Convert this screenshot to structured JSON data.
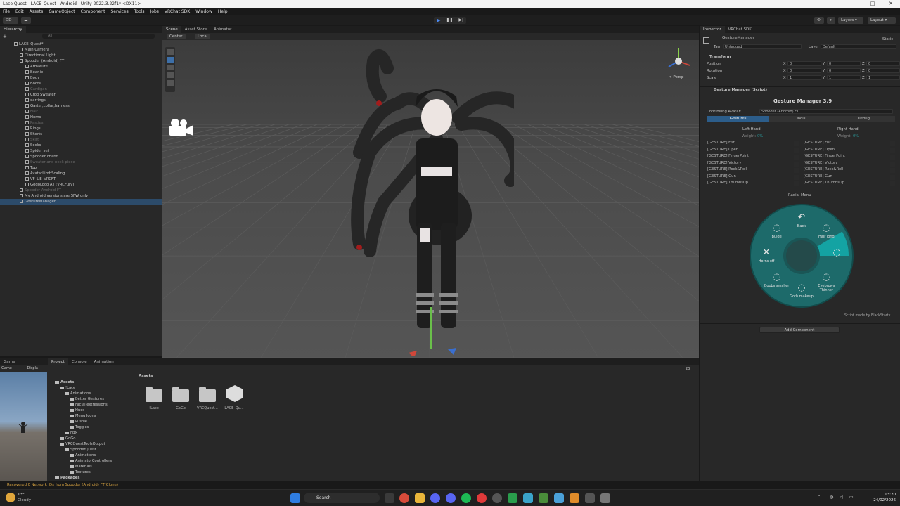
{
  "window": {
    "title": "Lace Quest - LACE_Quest - Android - Unity 2022.3.22f1* <DX11>",
    "controls": [
      "–",
      "□",
      "✕"
    ]
  },
  "menu": [
    "File",
    "Edit",
    "Assets",
    "GameObject",
    "Component",
    "Services",
    "Tools",
    "Jobs",
    "VRChat SDK",
    "Window",
    "Help"
  ],
  "toolbar": {
    "account": "DD",
    "layers": "Layers",
    "layout": "Layout"
  },
  "hierarchy": {
    "tab": "Hierarchy",
    "search_placeholder": "All",
    "items": [
      {
        "label": "LACE_Quest*",
        "indent": 0,
        "dim": false,
        "sel": false
      },
      {
        "label": "Main Camera",
        "indent": 1,
        "dim": false,
        "sel": false
      },
      {
        "label": "Directional Light",
        "indent": 1,
        "dim": false,
        "sel": false
      },
      {
        "label": "Spooder (Android) FT",
        "indent": 1,
        "dim": false,
        "sel": false
      },
      {
        "label": "Armature",
        "indent": 2,
        "dim": false,
        "sel": false
      },
      {
        "label": "Beanie",
        "indent": 2,
        "dim": false,
        "sel": false
      },
      {
        "label": "Body",
        "indent": 2,
        "dim": false,
        "sel": false
      },
      {
        "label": "Boots",
        "indent": 2,
        "dim": false,
        "sel": false
      },
      {
        "label": "Cardigan",
        "indent": 2,
        "dim": true,
        "sel": false
      },
      {
        "label": "Crop Sweater",
        "indent": 2,
        "dim": false,
        "sel": false
      },
      {
        "label": "earrings",
        "indent": 2,
        "dim": false,
        "sel": false
      },
      {
        "label": "Garter,collar,harness",
        "indent": 2,
        "dim": false,
        "sel": false
      },
      {
        "label": "Hair",
        "indent": 2,
        "dim": true,
        "sel": false
      },
      {
        "label": "Horns",
        "indent": 2,
        "dim": false,
        "sel": false
      },
      {
        "label": "Pasties",
        "indent": 2,
        "dim": true,
        "sel": false
      },
      {
        "label": "Rings",
        "indent": 2,
        "dim": false,
        "sel": false
      },
      {
        "label": "Shorts",
        "indent": 2,
        "dim": false,
        "sel": false
      },
      {
        "label": "Skirt",
        "indent": 2,
        "dim": true,
        "sel": false
      },
      {
        "label": "Socks",
        "indent": 2,
        "dim": false,
        "sel": false
      },
      {
        "label": "Spider set",
        "indent": 2,
        "dim": false,
        "sel": false
      },
      {
        "label": "Spooder charm",
        "indent": 2,
        "dim": false,
        "sel": false
      },
      {
        "label": "Sweater and neck piece",
        "indent": 2,
        "dim": true,
        "sel": false
      },
      {
        "label": "Top",
        "indent": 2,
        "dim": false,
        "sel": false
      },
      {
        "label": "AvatarLimbScaling",
        "indent": 2,
        "dim": false,
        "sel": false
      },
      {
        "label": "VF_UE_VRCFT",
        "indent": 2,
        "dim": false,
        "sel": false
      },
      {
        "label": "GogoLoco All (VRCFury)",
        "indent": 2,
        "dim": false,
        "sel": false
      },
      {
        "label": "Spooder Android FT",
        "indent": 1,
        "dim": true,
        "sel": false
      },
      {
        "label": "My Android versions are SFW only",
        "indent": 1,
        "dim": false,
        "sel": false
      },
      {
        "label": "GestureManager",
        "indent": 1,
        "dim": false,
        "sel": true
      }
    ]
  },
  "scene": {
    "tabs": [
      "Scene",
      "Asset Store",
      "Animator"
    ],
    "pivot": "Center",
    "space": "Local",
    "persp_label": "< Persp"
  },
  "inspector": {
    "tabs": [
      "Inspector",
      "VRChat SDK"
    ],
    "object_name": "GestureManager",
    "static_label": "Static",
    "tag_label": "Tag",
    "tag_value": "Untagged",
    "layer_label": "Layer",
    "layer_value": "Default",
    "transform": {
      "title": "Transform",
      "rows": [
        {
          "label": "Position",
          "x": "0",
          "y": "0",
          "z": "0"
        },
        {
          "label": "Rotation",
          "x": "0",
          "y": "0",
          "z": "0"
        },
        {
          "label": "Scale",
          "x": "1",
          "y": "1",
          "z": "1"
        }
      ]
    },
    "script_title": "Gesture Manager (Script)",
    "gm_title": "Gesture Manager 3.9",
    "controlling_label": "Controlling Avatar:",
    "controlling_value": "Spooder (Android) FT",
    "gm_tabs": [
      "Gestures",
      "Tools",
      "Debug"
    ],
    "left_hand": "Left Hand",
    "right_hand": "Right Hand",
    "weight_label": "Weight:",
    "weight_value": "0%",
    "gestures": [
      "[GESTURE] Fist",
      "[GESTURE] Open",
      "[GESTURE] FingerPoint",
      "[GESTURE] Victory",
      "[GESTURE] Rock&Roll",
      "[GESTURE] Gun",
      "[GESTURE] ThumbsUp"
    ],
    "radial_title": "Radial Menu",
    "radial_items": [
      {
        "label": "Back",
        "icon": "back-arrow-icon"
      },
      {
        "label": "Hair long",
        "icon": "toggle-icon"
      },
      {
        "label": "",
        "icon": "toggle-icon"
      },
      {
        "label": "Eyebrows Thinner",
        "icon": "toggle-icon"
      },
      {
        "label": "Goth makeup",
        "icon": "radial-icon"
      },
      {
        "label": "Boobs smaller",
        "icon": "toggle-icon"
      },
      {
        "label": "Horns off",
        "icon": "close-icon"
      },
      {
        "label": "Bulge",
        "icon": "radial-icon"
      }
    ],
    "credit": "Script made by BlackStartx",
    "add_component": "Add Component"
  },
  "bottom": {
    "tabs": [
      "Game",
      "Project",
      "Console",
      "Animation"
    ],
    "game_display": "Game",
    "game_display2": "Displa",
    "tree": [
      {
        "label": "Assets",
        "indent": 0
      },
      {
        "label": "!Lace",
        "indent": 1
      },
      {
        "label": "Animations",
        "indent": 2
      },
      {
        "label": "Better Gestures",
        "indent": 3
      },
      {
        "label": "Facial extressions",
        "indent": 3
      },
      {
        "label": "Hues",
        "indent": 3
      },
      {
        "label": "Menu Icons",
        "indent": 3
      },
      {
        "label": "Pushie",
        "indent": 3
      },
      {
        "label": "Toggles",
        "indent": 3
      },
      {
        "label": "FBX",
        "indent": 2
      },
      {
        "label": "GoGo",
        "indent": 1
      },
      {
        "label": "VRCQuestToolsOutput",
        "indent": 1
      },
      {
        "label": "SpooderQuest",
        "indent": 2
      },
      {
        "label": "Animations",
        "indent": 3
      },
      {
        "label": "AnimatorControllers",
        "indent": 3
      },
      {
        "label": "Materials",
        "indent": 3
      },
      {
        "label": "Textures",
        "indent": 3
      },
      {
        "label": "Packages",
        "indent": 0
      }
    ],
    "breadcrumb": "Assets",
    "assets": [
      "!Lace",
      "GoGo",
      "VRCQuest...",
      "LACE_Qu..."
    ],
    "count": "23"
  },
  "status": "Recovered 0 Network IDs from Spooder (Android) FT(Clone)",
  "taskbar": {
    "temp": "13°C",
    "weather": "Cloudy",
    "search": "Search",
    "time": "13:20",
    "date": "24/02/2026"
  },
  "colors": {
    "accent": "#1e7f7f",
    "radial_ring": "#1a6e6e",
    "radial_inner": "#135252",
    "radial_highlight": "#14a3a3",
    "selection": "#2c4b6a",
    "play_blue": "#4c8bf5"
  }
}
